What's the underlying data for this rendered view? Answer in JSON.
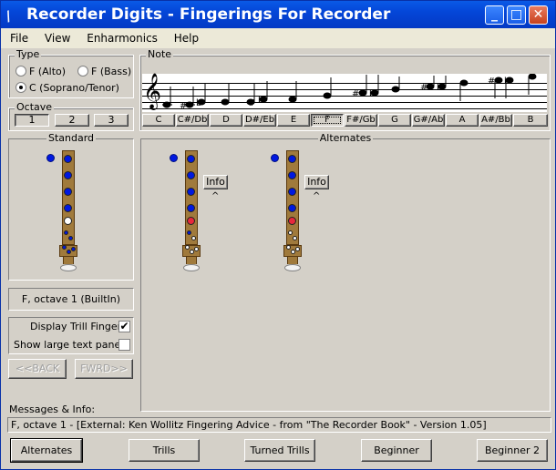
{
  "window": {
    "title": "Recorder Digits - Fingerings For Recorder",
    "minimize": "_",
    "maximize": "□",
    "close": "✕"
  },
  "menu": [
    "File",
    "View",
    "Enharmonics",
    "Help"
  ],
  "type_group": {
    "label": "Type",
    "options": [
      "F (Alto)",
      "F (Bass)",
      "C (Soprano/Tenor)"
    ],
    "selected": "C (Soprano/Tenor)"
  },
  "octave_group": {
    "label": "Octave",
    "buttons": [
      "1",
      "2",
      "3"
    ],
    "selected": "1"
  },
  "note_group": {
    "label": "Note",
    "notes": [
      "C",
      "C#/Db",
      "D",
      "D#/Eb",
      "E",
      "F",
      "F#/Gb",
      "G",
      "G#/Ab",
      "A",
      "A#/Bb",
      "B"
    ],
    "selected": "F"
  },
  "standard": {
    "label": "Standard",
    "fingering_name": "F, octave 1 (BuiltIn)"
  },
  "alternates": {
    "label": "Alternates",
    "info_label": "Info",
    "caret": "^"
  },
  "options": {
    "display_trill_fingers": "Display Trill Fingers",
    "display_trill_checked": true,
    "show_large_text": "Show large text panel",
    "show_large_checked": false,
    "check_glyph": "✔"
  },
  "nav": {
    "back": "<<BACK",
    "forward": "FWRD>>"
  },
  "messages": {
    "label": "Messages & Info:",
    "text": "F, octave 1 - [External: Ken Wollitz Fingering Advice - from \"The Recorder Book\" - Version 1.05]"
  },
  "bottom_buttons": [
    "Alternates",
    "Trills",
    "Turned Trills",
    "Beginner",
    "Beginner 2"
  ],
  "colors": {
    "closed_hole": "#0018e0",
    "trill_hole": "#e8283c",
    "recorder_body": "#a07a3c",
    "titlebar": "#0446d8"
  }
}
